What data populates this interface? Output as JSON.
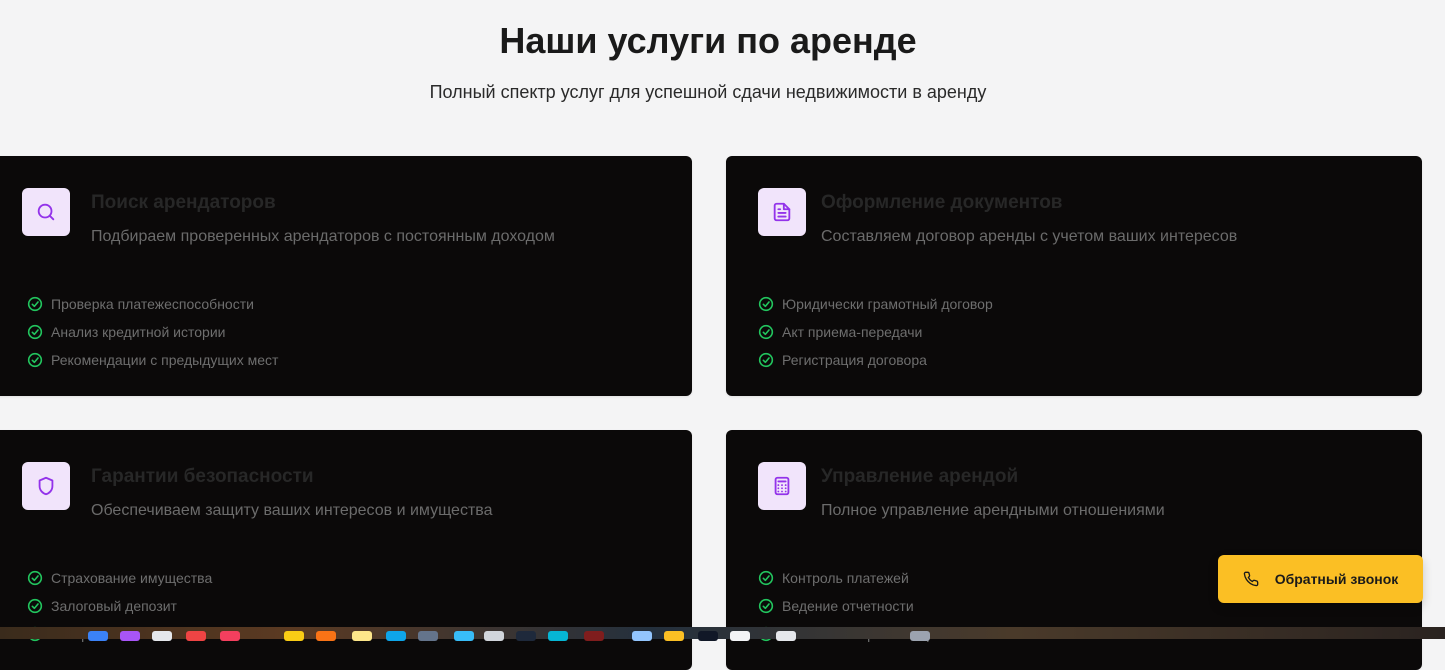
{
  "header": {
    "title": "Наши услуги по аренде",
    "subtitle": "Полный спектр услуг для успешной сдачи недвижимости в аренду"
  },
  "services": [
    {
      "icon": "search-icon",
      "title": "Поиск арендаторов",
      "description": "Подбираем проверенных арендаторов с постоянным доходом",
      "features": [
        "Проверка платежеспособности",
        "Анализ кредитной истории",
        "Рекомендации с предыдущих мест"
      ]
    },
    {
      "icon": "document-icon",
      "title": "Оформление документов",
      "description": "Составляем договор аренды с учетом ваших интересов",
      "features": [
        "Юридически грамотный договор",
        "Акт приема-передачи",
        "Регистрация договора"
      ]
    },
    {
      "icon": "shield-icon",
      "title": "Гарантии безопасности",
      "description": "Обеспечиваем защиту ваших интересов и имущества",
      "features": [
        "Страхование имущества",
        "Залоговый депозит",
        "Контроль состояния объекта"
      ]
    },
    {
      "icon": "calculator-icon",
      "title": "Управление арендой",
      "description": "Полное управление арендными отношениями",
      "features": [
        "Контроль платежей",
        "Ведение отчетности",
        "Решение спорных вопросов"
      ]
    }
  ],
  "callback_button": {
    "icon": "phone-icon",
    "label": "Обратный звонок"
  },
  "colors": {
    "accent": "#fbbf24",
    "icon_bg": "#f1e4fb",
    "icon_stroke": "#9333ea",
    "check": "#22c55e",
    "card_bg": "#0b0909"
  }
}
